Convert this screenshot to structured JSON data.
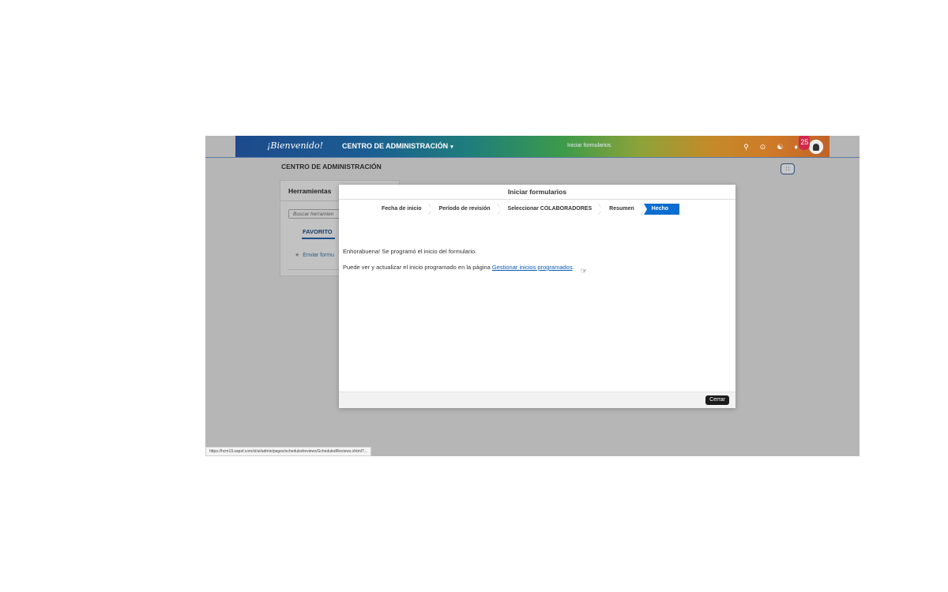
{
  "shellbar": {
    "logo": "¡Bienvenido!",
    "menu_label": "CENTRO DE ADMINISTRACIÓN",
    "center_title": "Iniciar formularios",
    "notification_count": "25",
    "icons": [
      "search-icon",
      "check-circle-icon",
      "help-icon",
      "bell-icon"
    ]
  },
  "page": {
    "title": "CENTRO DE ADMINISTRACIÓN"
  },
  "tools_panel": {
    "title": "Herramientas",
    "search_placeholder": "Buscar herramien",
    "tab_favorite": "FAVORITO",
    "favorite_item": "Enviar formu"
  },
  "dialog": {
    "title": "Iniciar formularios",
    "steps": [
      {
        "label": "Fecha de inicio"
      },
      {
        "label": "Período de revisión"
      },
      {
        "label": "Seleccionar COLABORADORES"
      },
      {
        "label": "Resumen"
      },
      {
        "label": "Hecho"
      }
    ],
    "message_1": "Enhorabuena! Se programó el inicio del formulario.",
    "message_2_prefix": "Puede ver y actualizar el inicio programado en la página ",
    "message_2_link": "Gestionar inicios programados",
    "message_2_suffix": ".",
    "close_label": "Cerrar"
  },
  "status_bar": {
    "url": "https://hcm19.sapsf.com/xi/ui/admin/pages/scheduledreviews/ScheduledReviews.xhtml?..."
  },
  "colors": {
    "accent": "#0a6ed1",
    "link": "#0a5bb5",
    "backdrop": "#b6b6b6"
  }
}
